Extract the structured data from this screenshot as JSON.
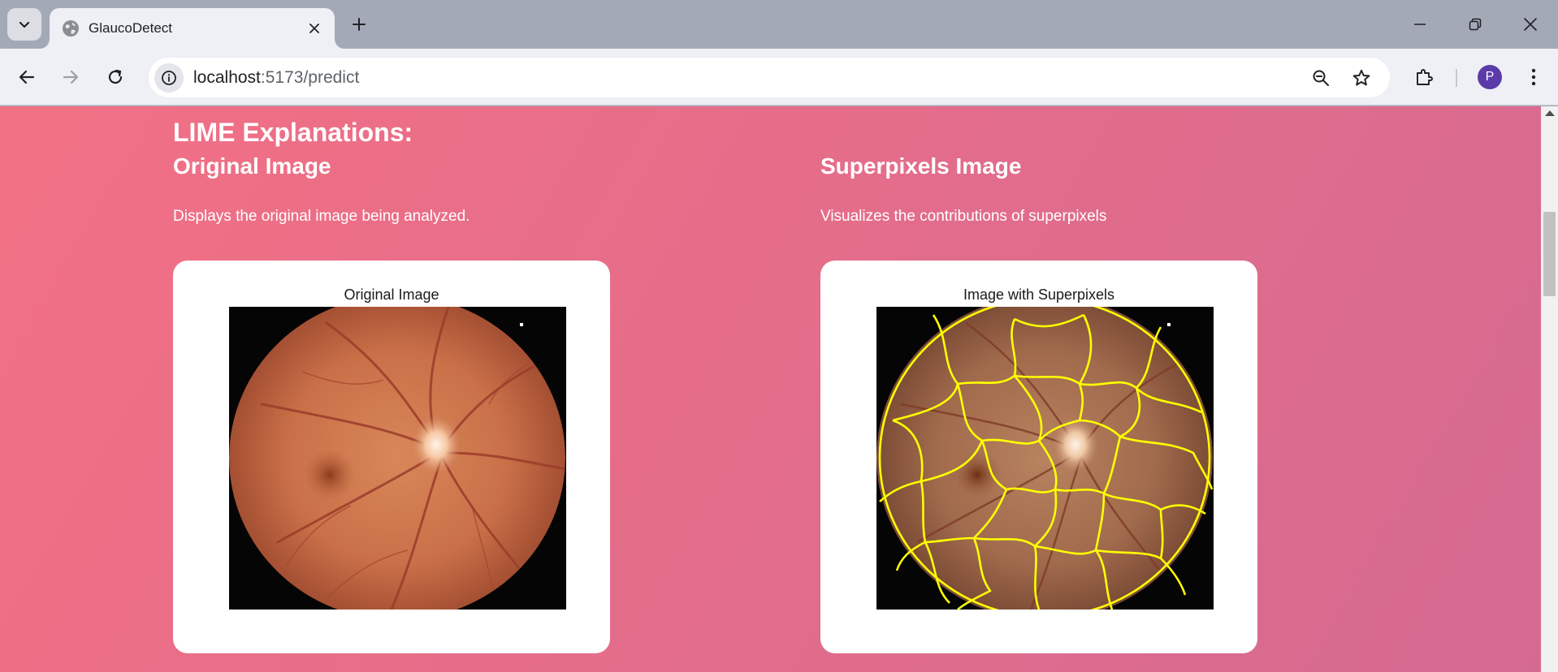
{
  "browser": {
    "tab_title": "GlaucoDetect",
    "url_host": "localhost",
    "url_path": ":5173/predict",
    "profile_initial": "P",
    "icons": [
      "tab-search-icon",
      "globe-icon",
      "close-icon",
      "plus-icon",
      "minimize-icon",
      "restore-icon",
      "back-icon",
      "forward-icon",
      "reload-icon",
      "site-info-icon",
      "zoom-icon",
      "star-icon",
      "extensions-icon",
      "more-icon"
    ]
  },
  "page": {
    "heading": "LIME Explanations:",
    "columns": [
      {
        "title": "Original Image",
        "description": "Displays the original image being analyzed.",
        "figure_caption": "Original Image"
      },
      {
        "title": "Superpixels Image",
        "description": "Visualizes the contributions of superpixels",
        "figure_caption": "Image with Superpixels"
      }
    ]
  },
  "colors": {
    "gradient_start": "#f27084",
    "gradient_end": "#d56a91",
    "superpixel_boundary": "#ffff00",
    "avatar": "#5b3ba8"
  }
}
